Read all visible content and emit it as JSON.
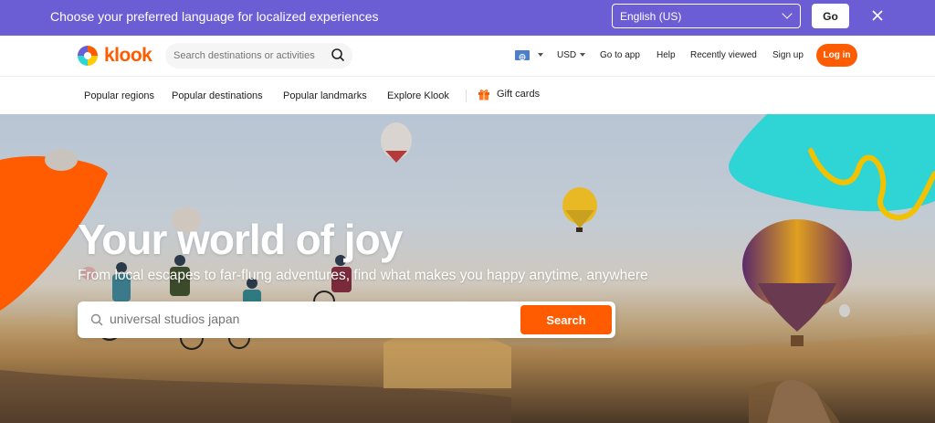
{
  "banner": {
    "message": "Choose your preferred language for localized experiences",
    "language_value": "English (US)",
    "go_label": "Go"
  },
  "header": {
    "brand": "klook",
    "search_placeholder": "Search destinations or activities",
    "currency": "USD",
    "links": [
      "Go to app",
      "Help",
      "Recently viewed",
      "Sign up"
    ],
    "login_label": "Log in"
  },
  "category_nav": {
    "items": [
      "Popular regions",
      "Popular destinations",
      "Popular landmarks",
      "Explore Klook"
    ],
    "gift_label": "Gift cards"
  },
  "hero": {
    "title": "Your world of joy",
    "subtitle": "From local escapes to far-flung adventures, find what makes you happy anytime, anywhere",
    "search_value": "universal studios japan",
    "search_button": "Search"
  },
  "colors": {
    "brand_orange": "#ff5b00",
    "banner_purple": "#6b5dd3",
    "accent_teal": "#2fd4d4",
    "accent_yellow": "#f2c200"
  }
}
